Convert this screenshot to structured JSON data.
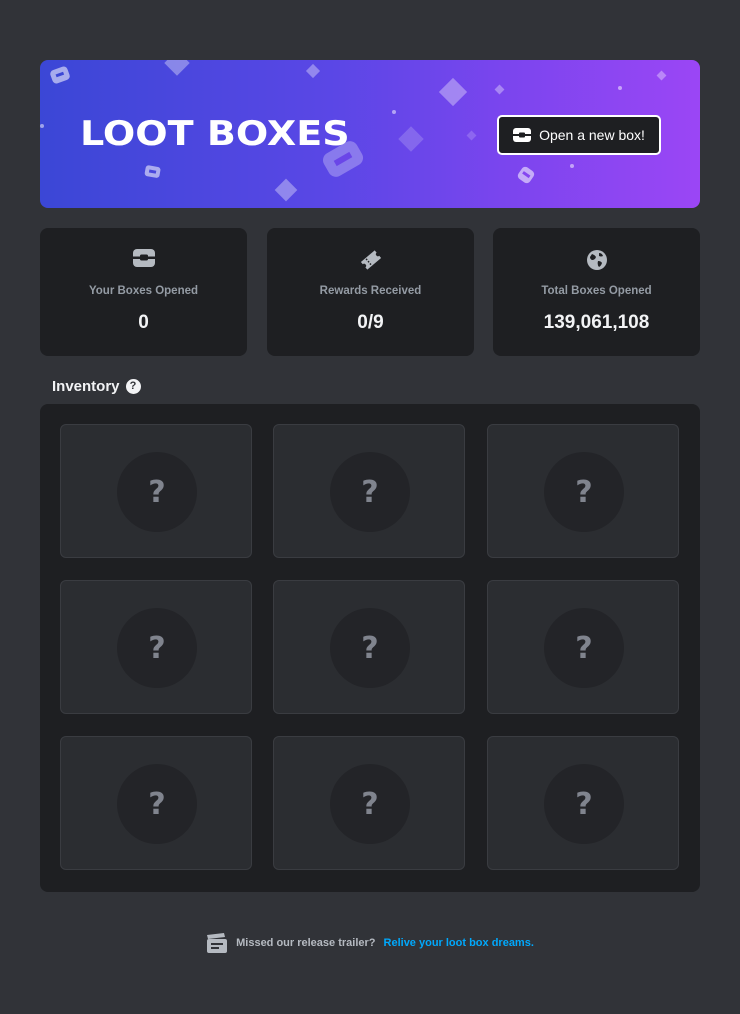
{
  "banner": {
    "title": "LOOT BOXES",
    "open_button_label": "Open a new box!",
    "open_button_icon": "loot-box-icon"
  },
  "stats": [
    {
      "icon": "loot-box-icon",
      "label": "Your Boxes Opened",
      "value": "0"
    },
    {
      "icon": "ticket-icon",
      "label": "Rewards Received",
      "value": "0/9"
    },
    {
      "icon": "globe-icon",
      "label": "Total Boxes Opened",
      "value": "139,061,108"
    }
  ],
  "inventory": {
    "title": "Inventory",
    "help_icon": "question-icon",
    "slots": [
      "?",
      "?",
      "?",
      "?",
      "?",
      "?",
      "?",
      "?",
      "?"
    ]
  },
  "footer": {
    "icon": "clapperboard-icon",
    "text": "Missed our release trailer?",
    "link": "Relive your loot box dreams."
  },
  "colors": {
    "background": "#313338",
    "card": "#1e1f22",
    "slot": "#2b2d31",
    "link": "#00a8fc",
    "banner_start": "#3b47d6",
    "banner_end": "#9b46f5"
  }
}
